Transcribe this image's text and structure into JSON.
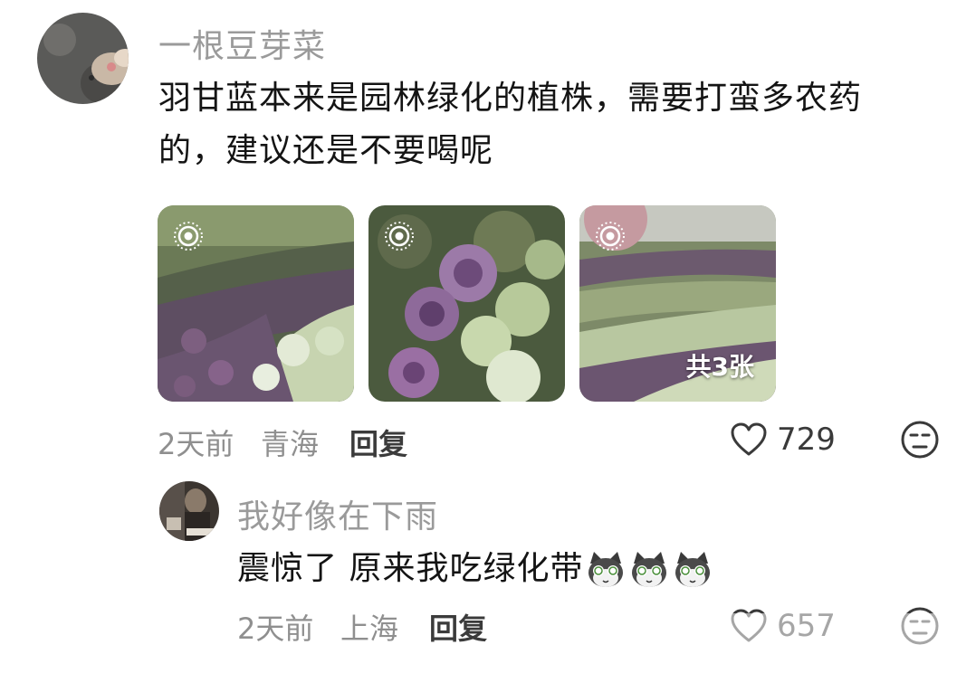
{
  "comment1": {
    "username": "一根豆芽菜",
    "text_line1": "羽甘蓝本来是园林绿化的植株，需要打蛮多农药",
    "text_line2": "的，建议还是不要喝呢",
    "images": [
      {
        "type": "live-photo"
      },
      {
        "type": "live-photo"
      },
      {
        "type": "live-photo",
        "count_label": "共3张"
      }
    ],
    "time": "2天前",
    "location": "青海",
    "reply_label": "回复",
    "like_count": "729"
  },
  "comment2": {
    "username": "我好像在下雨",
    "text": "震惊了 原来我吃绿化带",
    "emoji_count": 3,
    "time": "2天前",
    "location": "上海",
    "reply_label": "回复",
    "like_count": "657"
  },
  "icons": {
    "like": "heart-outline-icon",
    "dislike": "meh-face-icon",
    "live": "live-photo-icon",
    "emoji": "shocked-cat-emoji"
  },
  "colors": {
    "username": "#9a9a9a",
    "text": "#141414",
    "meta": "#8f8f8f"
  }
}
